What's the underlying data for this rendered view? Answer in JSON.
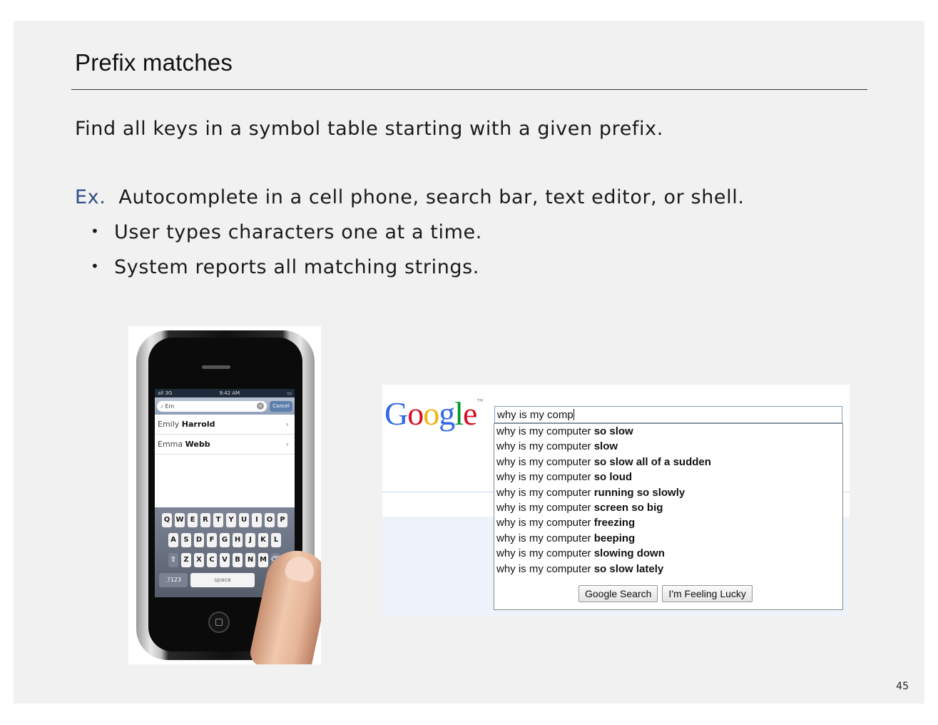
{
  "slide": {
    "title": "Prefix matches",
    "line1": "Find all keys in a symbol table starting with a given prefix.",
    "ex_label": "Ex.",
    "ex_text": "Autocomplete in a cell phone, search bar, text editor, or shell.",
    "bullets": [
      "User types characters one at a time.",
      "System reports all matching strings."
    ],
    "page_number": "45"
  },
  "phone": {
    "status_signal": "all 3G",
    "status_time": "9:42 AM",
    "search_text": "Em",
    "cancel_label": "Cancel",
    "contacts": [
      {
        "first": "Emily",
        "last": "Harrold"
      },
      {
        "first": "Emma",
        "last": "Webb"
      }
    ],
    "keys_row1": [
      "Q",
      "W",
      "E",
      "R",
      "T",
      "Y",
      "U",
      "I",
      "O",
      "P"
    ],
    "keys_row2": [
      "A",
      "S",
      "D",
      "F",
      "G",
      "H",
      "J",
      "K",
      "L"
    ],
    "keys_row3": [
      "Z",
      "X",
      "C",
      "V",
      "B",
      "N",
      "M"
    ],
    "numbers_key": ".?123",
    "space_key": "space"
  },
  "google": {
    "logo": "Google",
    "logo_colors": [
      "#3369e8",
      "#d50f25",
      "#eeb211",
      "#3369e8",
      "#009925",
      "#d50f25"
    ],
    "query": "why is my comp",
    "suggestions": [
      {
        "typed": "why is my comp",
        "rest_plain": "uter",
        "rest_bold": "so slow"
      },
      {
        "typed": "why is my comp",
        "rest_plain": "uter",
        "rest_bold": "slow"
      },
      {
        "typed": "why is my comp",
        "rest_plain": "uter",
        "rest_bold": "so slow all of a sudden"
      },
      {
        "typed": "why is my comp",
        "rest_plain": "uter",
        "rest_bold": "so loud"
      },
      {
        "typed": "why is my comp",
        "rest_plain": "uter",
        "rest_bold": "running so slowly"
      },
      {
        "typed": "why is my comp",
        "rest_plain": "uter",
        "rest_bold": "screen so big"
      },
      {
        "typed": "why is my comp",
        "rest_plain": "uter",
        "rest_bold": "freezing"
      },
      {
        "typed": "why is my comp",
        "rest_plain": "uter",
        "rest_bold": "beeping"
      },
      {
        "typed": "why is my comp",
        "rest_plain": "uter",
        "rest_bold": "slowing down"
      },
      {
        "typed": "why is my comp",
        "rest_plain": "uter",
        "rest_bold": "so slow lately"
      }
    ],
    "search_button": "Google Search",
    "lucky_button": "I'm Feeling Lucky"
  }
}
